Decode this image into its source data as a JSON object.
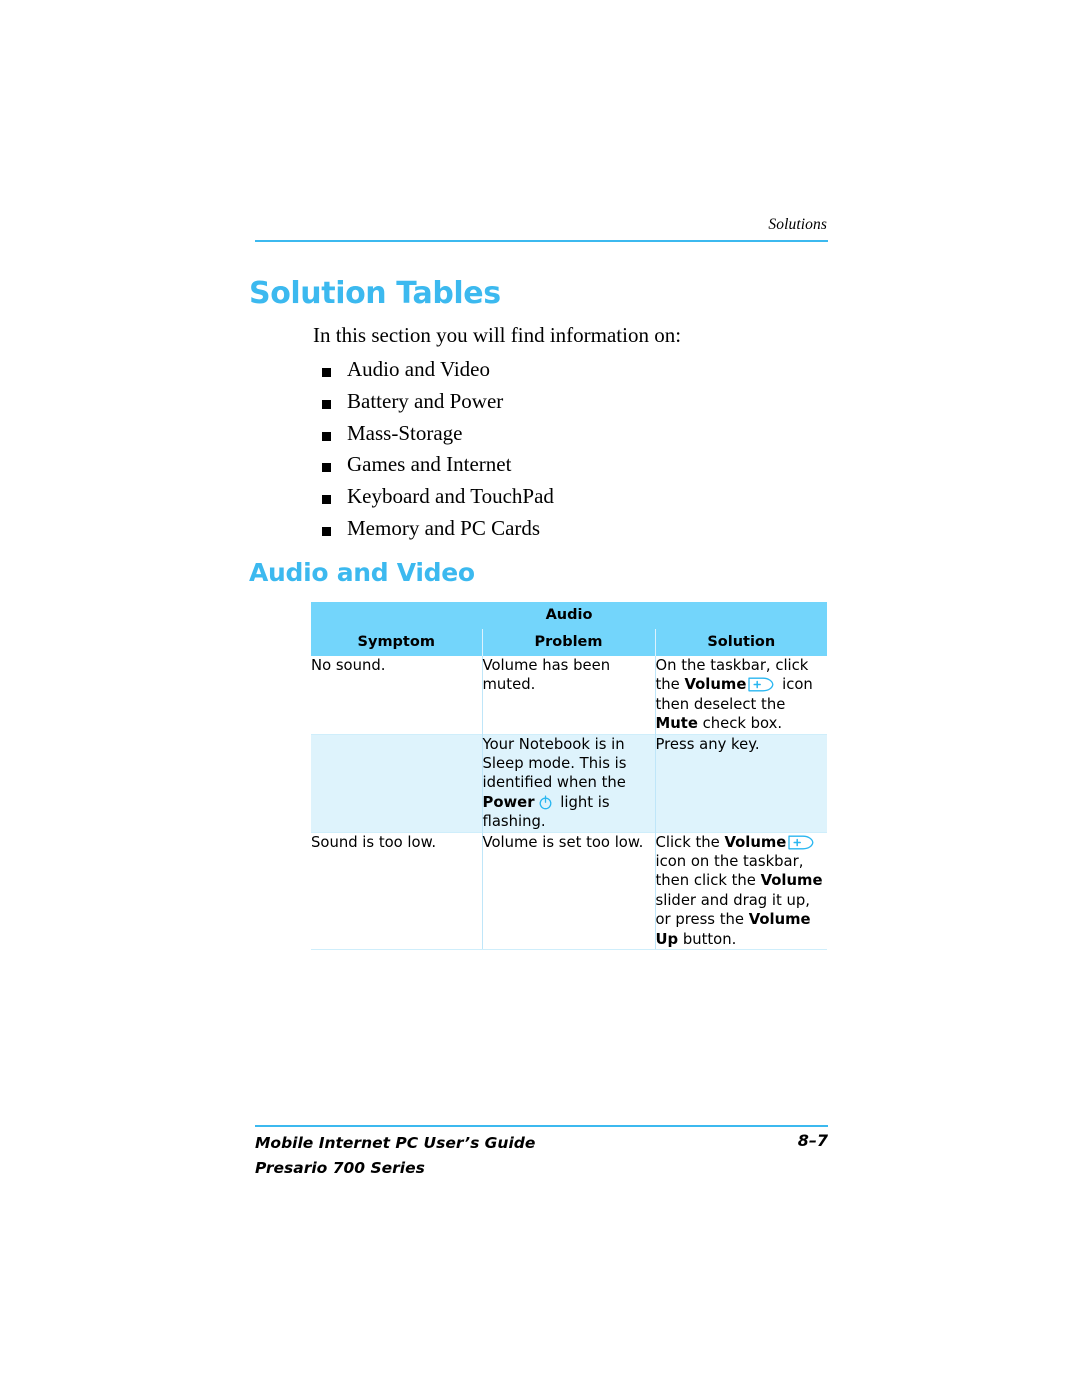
{
  "running_head": "Solutions",
  "headings": {
    "h1": "Solution Tables",
    "h2": "Audio and Video"
  },
  "intro": "In this section you will find information on:",
  "bullets": [
    "Audio and Video",
    "Battery and Power",
    "Mass-Storage",
    "Games and Internet",
    "Keyboard and TouchPad",
    "Memory and PC Cards"
  ],
  "table": {
    "title": "Audio",
    "columns": [
      "Symptom",
      "Problem",
      "Solution"
    ],
    "rows": [
      {
        "tint": false,
        "symptom": "No sound.",
        "problem": "Volume has been muted.",
        "solution_parts": [
          {
            "t": "text",
            "v": "On the taskbar, click the "
          },
          {
            "t": "bold",
            "v": "Volume"
          },
          {
            "t": "icon",
            "v": "volume-icon"
          },
          {
            "t": "text",
            "v": " icon then deselect the "
          },
          {
            "t": "bold",
            "v": "Mute"
          },
          {
            "t": "text",
            "v": " check box."
          }
        ]
      },
      {
        "tint": true,
        "symptom": "",
        "problem_parts": [
          {
            "t": "text",
            "v": "Your Notebook is in Sleep mode. This is identified when the "
          },
          {
            "t": "bold",
            "v": "Power"
          },
          {
            "t": "icon",
            "v": "power-icon"
          },
          {
            "t": "text",
            "v": " light is flashing."
          }
        ],
        "solution": "Press any key."
      },
      {
        "tint": false,
        "symptom": "Sound is too low.",
        "problem": "Volume is set too low.",
        "solution_parts": [
          {
            "t": "text",
            "v": "Click the "
          },
          {
            "t": "bold",
            "v": "Volume"
          },
          {
            "t": "icon",
            "v": "volume-icon"
          },
          {
            "t": "text",
            "v": " icon on the taskbar, then click the "
          },
          {
            "t": "bold",
            "v": "Volume"
          },
          {
            "t": "text",
            "v": " slider and drag it up, or press the "
          },
          {
            "t": "bold",
            "v": "Volume Up"
          },
          {
            "t": "text",
            "v": " button."
          }
        ]
      }
    ]
  },
  "footer": {
    "line1": "Mobile Internet PC User’s Guide",
    "line2": "Presario 700 Series",
    "page": "8–7"
  },
  "colors": {
    "accent_blue": "#3cb9ef",
    "header_fill": "#73d5fb",
    "row_tint": "#def3fc",
    "cell_border": "#bfe6f9"
  }
}
